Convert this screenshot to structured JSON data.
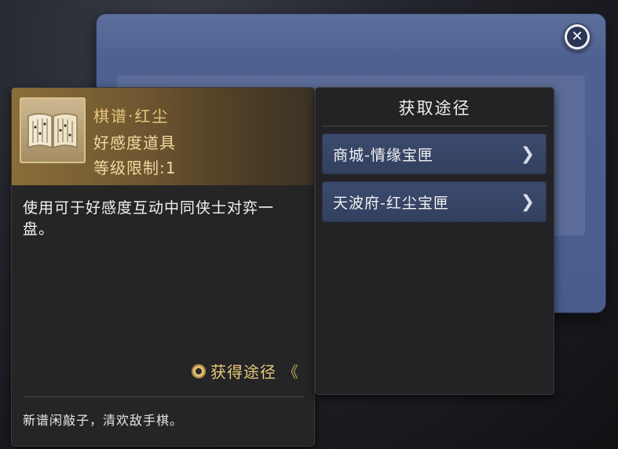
{
  "item": {
    "name": "棋谱·红尘",
    "type": "好感度道具",
    "level": "等级限制:1",
    "description": "使用可于好感度互动中同侠士对弈一盘。",
    "obtain_link": "获得途径",
    "obtain_arrows": "《",
    "flavor": "新谱闲敲子，清欢敌手棋。",
    "icon": "open-book-icon"
  },
  "routes": {
    "title": "获取途径",
    "items": [
      {
        "label": "商城-情缘宝匣",
        "icon": "chevron-right-icon"
      },
      {
        "label": "天波府-红尘宝匣",
        "icon": "chevron-right-icon"
      }
    ]
  },
  "window": {
    "close_icon": "close-icon"
  },
  "colors": {
    "gold_text": "#e8c77a",
    "route_button": "#3c4a6e",
    "window_blue": "#4e6191"
  }
}
